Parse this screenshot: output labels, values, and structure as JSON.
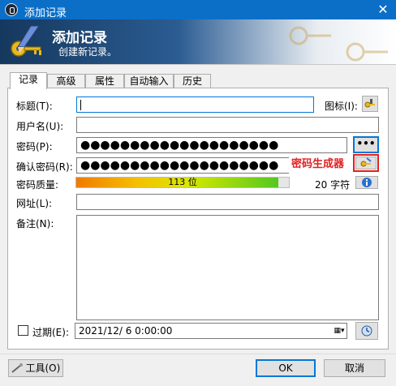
{
  "window": {
    "title": "添加记录",
    "close_glyph": "✕"
  },
  "banner": {
    "heading": "添加记录",
    "subtitle": "创建新记录。"
  },
  "tabs": [
    {
      "label": "记录",
      "active": true
    },
    {
      "label": "高级",
      "active": false
    },
    {
      "label": "属性",
      "active": false
    },
    {
      "label": "自动输入",
      "active": false
    },
    {
      "label": "历史",
      "active": false
    }
  ],
  "form": {
    "title_label": "标题(T):",
    "title_value": "",
    "icon_label": "图标(I):",
    "username_label": "用户名(U):",
    "username_value": "",
    "password_label": "密码(P):",
    "password_value": "●●●●●●●●●●●●●●●●●●●●",
    "show_password_label": "•••",
    "confirm_label": "确认密码(R):",
    "confirm_value": "●●●●●●●●●●●●●●●●●●●●",
    "generator_annotation": "密码生成器",
    "quality_label": "密码质量:",
    "quality_text": "113 位",
    "quality_fraction": 0.95,
    "char_count": "20 字符",
    "url_label": "网址(L):",
    "url_value": "",
    "notes_label": "备注(N):",
    "notes_value": "",
    "expires_label": "过期(E):",
    "expires_checked": false,
    "expires_value": "2021/12/ 6   0:00:00"
  },
  "footer": {
    "tools_label": "工具(O)",
    "ok_label": "OK",
    "cancel_label": "取消"
  },
  "colors": {
    "titlebar": "#0b6fc8",
    "accent_red": "#e02020",
    "focus_border": "#0078d7"
  }
}
